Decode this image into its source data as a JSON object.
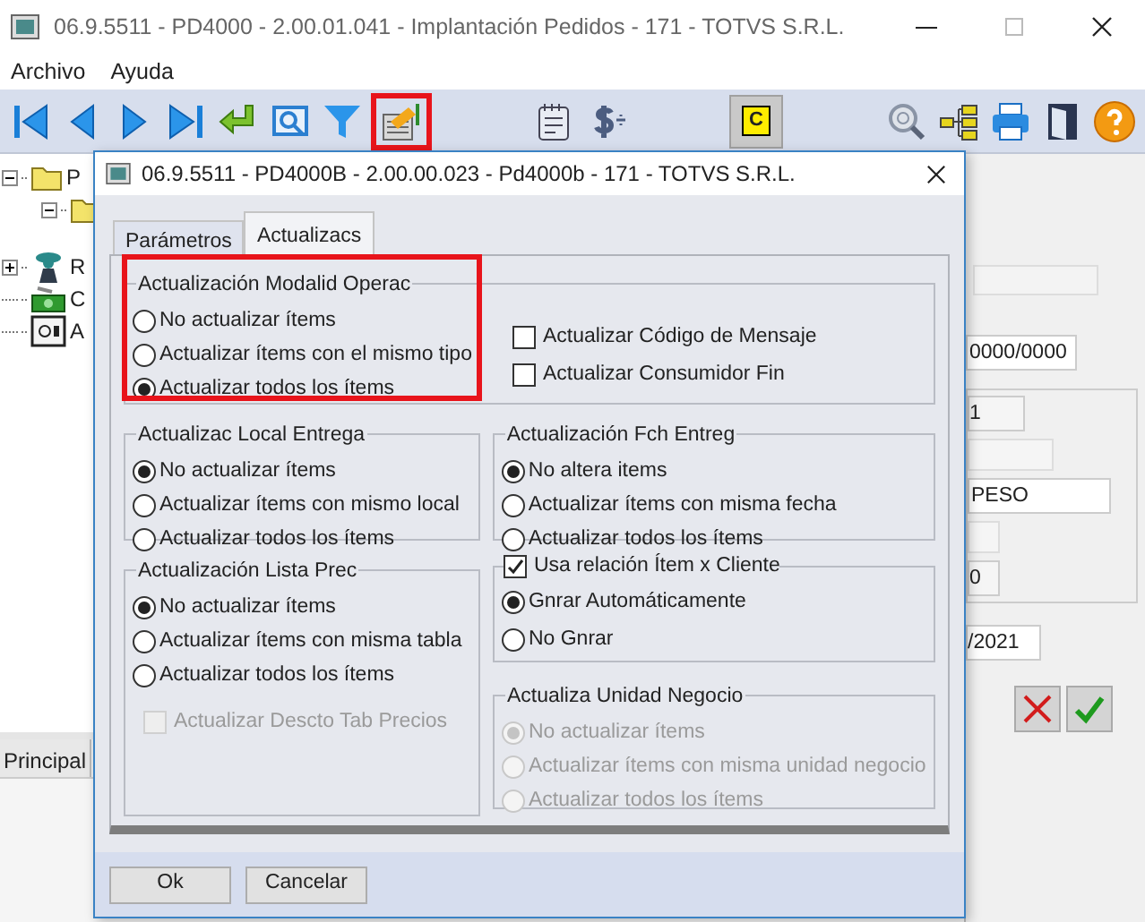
{
  "main_window": {
    "title": "06.9.5511 - PD4000 - 2.00.01.041 - Implantación Pedidos - 171 - TOTVS S.R.L.",
    "menu": [
      "Archivo",
      "Ayuda"
    ],
    "toolbar": [
      {
        "kind": "first",
        "highlighted": false
      },
      {
        "kind": "prev",
        "highlighted": false
      },
      {
        "kind": "next",
        "highlighted": false
      },
      {
        "kind": "last",
        "highlighted": false
      },
      {
        "kind": "enter",
        "highlighted": false
      },
      {
        "kind": "preview",
        "highlighted": false
      },
      {
        "kind": "filter",
        "highlighted": false
      },
      {
        "kind": "edit",
        "highlighted": true
      },
      {
        "kind": "spacer"
      },
      {
        "kind": "notepad",
        "highlighted": false
      },
      {
        "kind": "dollar",
        "highlighted": false
      },
      {
        "kind": "spacer"
      },
      {
        "kind": "letter",
        "label": "C",
        "highlighted": false
      },
      {
        "kind": "spacer"
      },
      {
        "kind": "search",
        "highlighted": false
      },
      {
        "kind": "tree",
        "highlighted": false
      },
      {
        "kind": "print",
        "highlighted": false
      },
      {
        "kind": "exit",
        "highlighted": false
      },
      {
        "kind": "help",
        "highlighted": false
      }
    ],
    "tree": [
      {
        "kind": "folder",
        "label": "P",
        "expanded": true,
        "children": [
          {
            "kind": "folder",
            "expanded": true
          }
        ]
      },
      {
        "kind": "person",
        "label": "R",
        "expanded": false
      },
      {
        "kind": "money",
        "label": "C"
      },
      {
        "kind": "safe",
        "label": "A"
      }
    ],
    "bottom_tab": "Principal",
    "fields": [
      "0000/0000",
      "1",
      "PESO",
      "0",
      "/2021"
    ],
    "action_buttons": [
      {
        "kind": "cancel"
      },
      {
        "kind": "confirm"
      }
    ]
  },
  "dialog": {
    "title": "06.9.5511 - PD4000B - 2.00.00.023 - Pd4000b - 171 - TOTVS S.R.L.",
    "tabs": [
      {
        "label": "Parámetros",
        "selected": false
      },
      {
        "label": "Actualizacs",
        "selected": true
      }
    ],
    "modalidad": {
      "title": "Actualización Modalid Operac",
      "highlighted": true,
      "options": [
        {
          "label": "No actualizar ítems",
          "selected": false
        },
        {
          "label": "Actualizar ítems con el mismo tipo",
          "selected": false
        },
        {
          "label": "Actualizar todos los ítems",
          "selected": true
        }
      ],
      "checkboxes": [
        {
          "label": "Actualizar Código de Mensaje",
          "checked": false,
          "disabled": false
        },
        {
          "label": "Actualizar Consumidor Fin",
          "checked": false,
          "disabled": false
        }
      ]
    },
    "local_entrega": {
      "title": "Actualizac Local Entrega",
      "options": [
        {
          "label": "No actualizar ítems",
          "selected": true,
          "disabled": false
        },
        {
          "label": "Actualizar ítems con mismo local",
          "selected": false,
          "disabled": false
        },
        {
          "label": "Actualizar todos los ítems",
          "selected": false,
          "disabled": false
        }
      ]
    },
    "fch_entreg": {
      "title": "Actualización Fch Entreg",
      "options": [
        {
          "label": "No altera items",
          "selected": true,
          "disabled": false
        },
        {
          "label": "Actualizar ítems con misma fecha",
          "selected": false,
          "disabled": false
        },
        {
          "label": "Actualizar todos los ítems",
          "selected": false,
          "disabled": false
        }
      ]
    },
    "lista_prec": {
      "title": "Actualización Lista Prec",
      "options": [
        {
          "label": "No actualizar ítems",
          "selected": true,
          "disabled": false
        },
        {
          "label": "Actualizar ítems con misma tabla",
          "selected": false,
          "disabled": false
        },
        {
          "label": "Actualizar todos los ítems",
          "selected": false,
          "disabled": false
        }
      ],
      "checkbox": {
        "label": "Actualizar Descto Tab Precios",
        "checked": false,
        "disabled": true
      }
    },
    "item_cliente": {
      "title": "Usa relación Ítem x Cliente",
      "checked": true,
      "options": [
        {
          "label": "Gnrar Automáticamente",
          "selected": true,
          "disabled": false
        },
        {
          "label": "No Gnrar",
          "selected": false,
          "disabled": false
        }
      ]
    },
    "unidad_negocio": {
      "title": "Actualiza Unidad Negocio",
      "options": [
        {
          "label": "No actualizar ítems",
          "selected": true,
          "disabled": true
        },
        {
          "label": "Actualizar ítems con misma unidad negocio",
          "selected": false,
          "disabled": true
        },
        {
          "label": "Actualizar todos los ítems",
          "selected": false,
          "disabled": true
        }
      ]
    },
    "buttons": [
      "Ok",
      "Cancelar"
    ]
  }
}
